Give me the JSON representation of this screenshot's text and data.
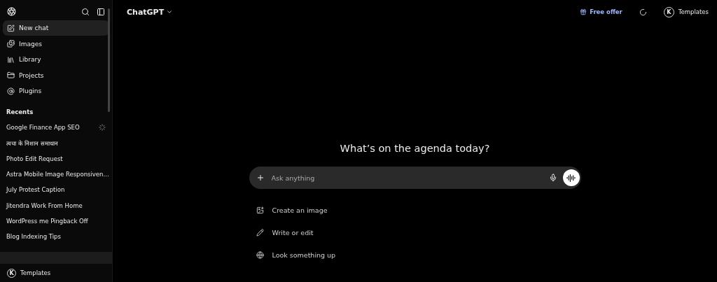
{
  "sidebar": {
    "nav": [
      {
        "label": "New chat",
        "selected": true
      },
      {
        "label": "Images",
        "selected": false
      },
      {
        "label": "Library",
        "selected": false
      },
      {
        "label": "Projects",
        "selected": false
      },
      {
        "label": "Plugins",
        "selected": false
      }
    ],
    "recents_heading": "Recents",
    "recents": [
      {
        "label": "Google Finance App SEO",
        "loading": true
      },
      {
        "label": "त्वचा के निशान समाधान",
        "loading": false
      },
      {
        "label": "Photo Edit Request",
        "loading": false
      },
      {
        "label": "Astra Mobile Image Responsiven...",
        "loading": false
      },
      {
        "label": "July Protest Caption",
        "loading": false
      },
      {
        "label": "Jitendra Work From Home",
        "loading": false
      },
      {
        "label": "WordPress me Pingback Off",
        "loading": false
      },
      {
        "label": "Blog Indexing Tips",
        "loading": false
      }
    ],
    "account": {
      "initial": "K",
      "label": "Templates"
    }
  },
  "header": {
    "title": "ChatGPT",
    "offer": "Free offer",
    "account": {
      "initial": "K",
      "label": "Templates"
    }
  },
  "main": {
    "heading": "What’s on the agenda today?",
    "composer": {
      "placeholder": "Ask anything"
    },
    "suggestions": [
      {
        "label": "Create an image"
      },
      {
        "label": "Write or edit"
      },
      {
        "label": "Look something up"
      }
    ]
  }
}
